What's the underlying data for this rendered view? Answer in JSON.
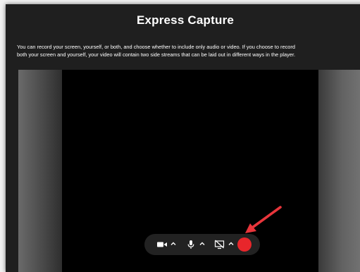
{
  "app": {
    "title": "Express Capture",
    "description_line1": "You can record your screen, yourself, or both, and choose whether to include only audio or video. If you choose to record",
    "description_line2": "both your screen and yourself, your video will contain two side streams that can be laid out in different ways in the player."
  },
  "toolbar": {
    "camera_icon": "video-camera-icon",
    "microphone_icon": "microphone-icon",
    "screen_icon": "screen-share-off-icon",
    "chevron_icon": "chevron-up-icon",
    "record_icon": "record-dot-icon"
  },
  "annotation": {
    "arrow_icon": "red-arrow-icon"
  },
  "colors": {
    "background": "#1f1f1f",
    "stage": "#000000",
    "toolbar": "#222222",
    "record": "#e8262b",
    "arrow": "#e8353b",
    "text": "#ffffff"
  }
}
